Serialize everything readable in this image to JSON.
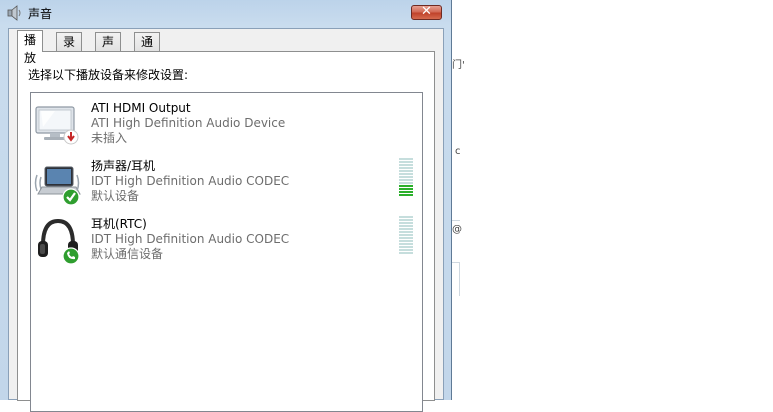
{
  "window": {
    "title": "声音",
    "close_glyph": "✕"
  },
  "tabs": [
    {
      "label": "播放",
      "active": true
    },
    {
      "label": "录制",
      "active": false
    },
    {
      "label": "声音",
      "active": false
    },
    {
      "label": "通信",
      "active": false
    }
  ],
  "instruction": "选择以下播放设备来修改设置:",
  "devices": [
    {
      "name": "ATI HDMI Output",
      "driver": "ATI High Definition Audio Device",
      "status": "未插入",
      "icon": "monitor-icon",
      "badge": "unplugged-badge-icon"
    },
    {
      "name": "扬声器/耳机",
      "driver": "IDT High Definition Audio CODEC",
      "status": "默认设备",
      "icon": "laptop-speakers-icon",
      "badge": "default-check-badge-icon",
      "level_fraction": 0.3
    },
    {
      "name": "耳机(RTC)",
      "driver": "IDT High Definition Audio CODEC",
      "status": "默认通信设备",
      "icon": "headphones-icon",
      "badge": "communications-phone-badge-icon",
      "level_fraction": 0
    }
  ],
  "background_fragments": {
    "frag1": "门'",
    "frag2": "c",
    "frag3": "@"
  },
  "colors": {
    "meter_on": "#2bb02b",
    "meter_off": "#c6dedd",
    "accent_check": "#2f9e2f"
  }
}
